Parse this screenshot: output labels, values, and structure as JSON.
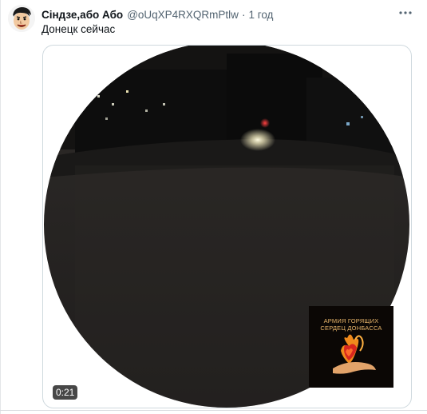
{
  "tweet": {
    "display_name": "Сіндзе,або Або",
    "handle": "@oUqXP4RXQRmPtlw",
    "separator": "·",
    "time": "1 год",
    "text": "Донецк сейчас",
    "more_icon": "more-horizontal-icon",
    "avatar_icon": "cartoon-face-avatar"
  },
  "video": {
    "duration": "0:21",
    "watermark": {
      "line1": "АРМИЯ ГОРЯЩИХ",
      "line2": "СЕРДЕЦ ДОНБАССА",
      "icon": "burning-heart-in-hand-logo"
    }
  }
}
